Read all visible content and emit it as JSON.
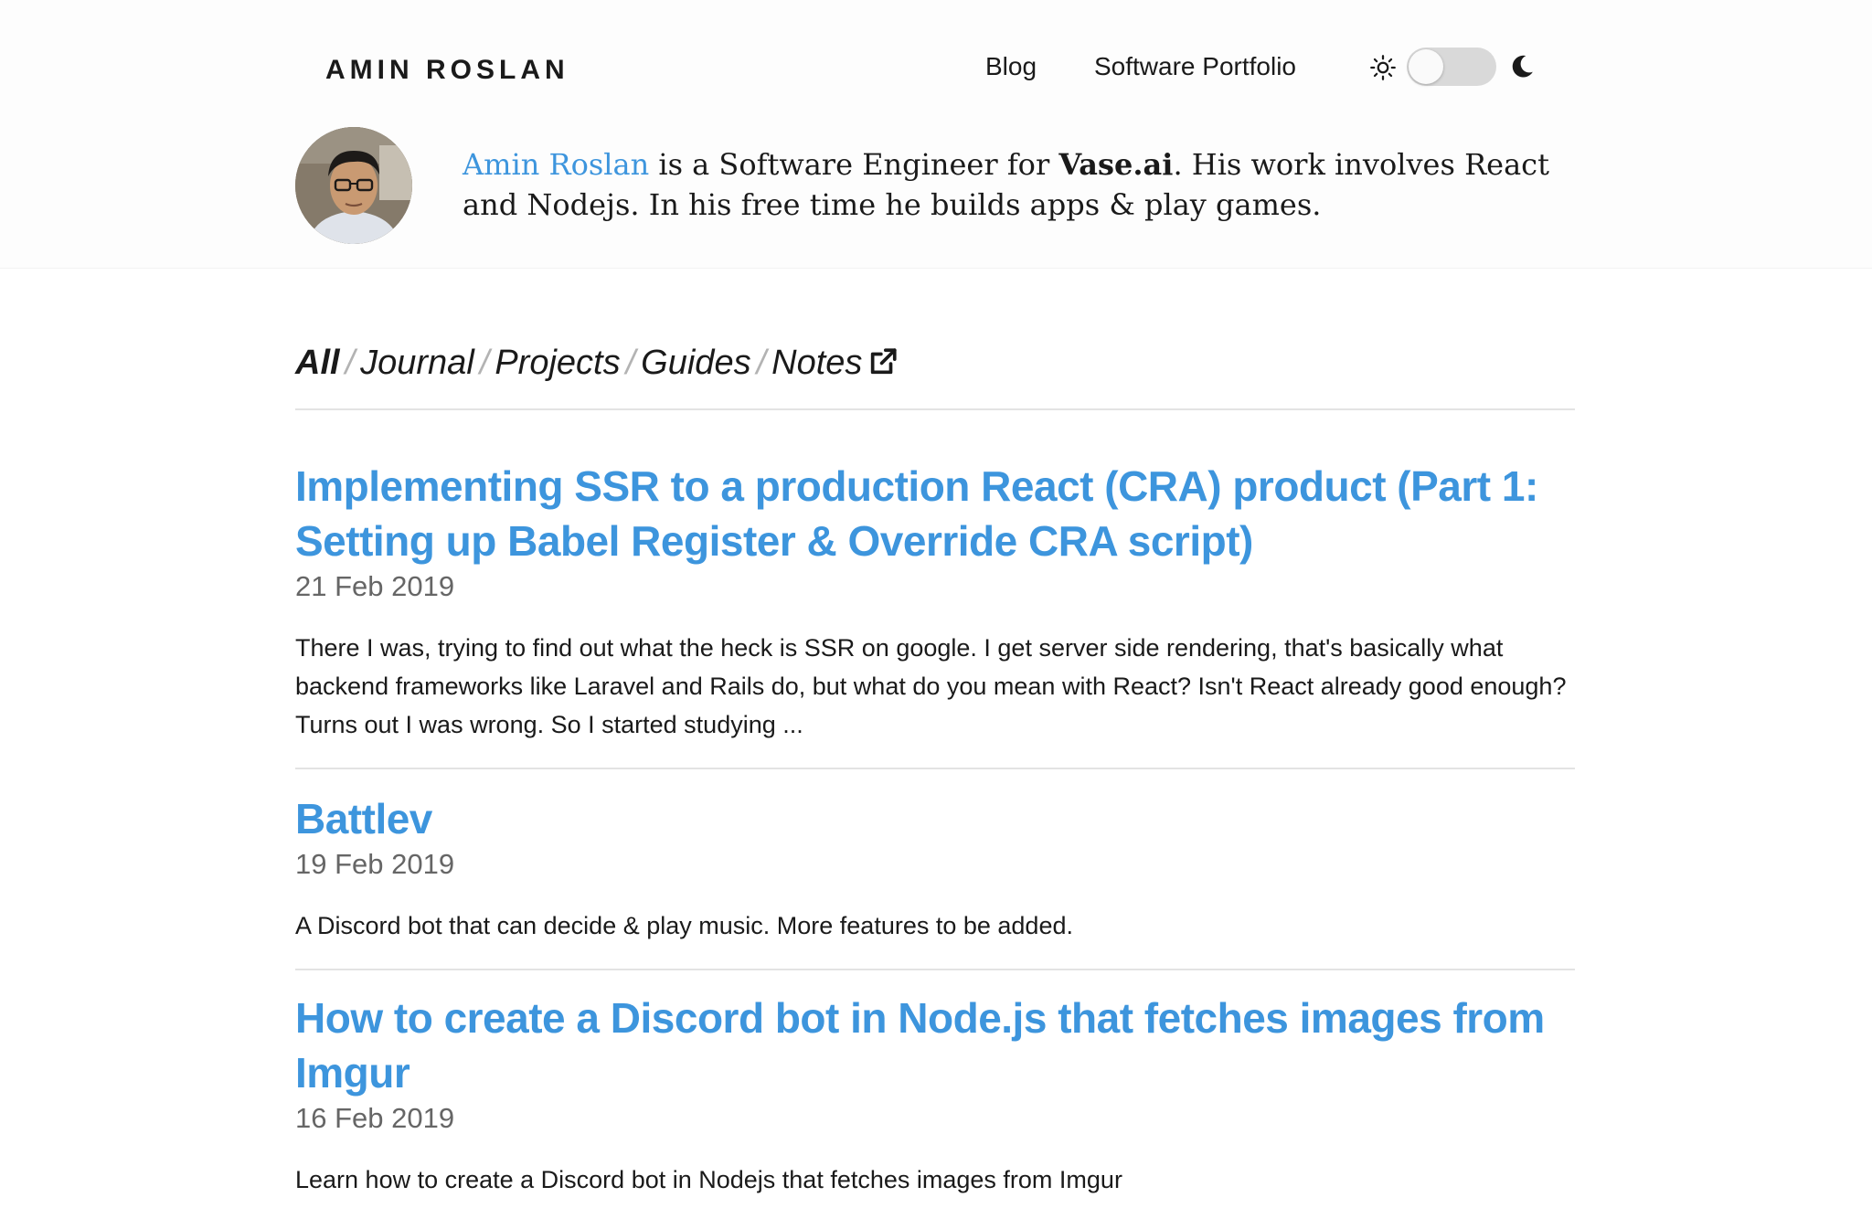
{
  "header": {
    "brand": "AMIN ROSLAN",
    "nav": {
      "blog": "Blog",
      "portfolio": "Software Portfolio"
    },
    "bio": {
      "name": "Amin Roslan",
      "text1": " is a Software Engineer for ",
      "company": "Vase.ai",
      "text2": ". His work involves React and Nodejs. In his free time he builds apps & play games."
    }
  },
  "theme_toggle": {
    "checked": false,
    "light_icon": "sun-icon",
    "dark_icon": "moon-icon"
  },
  "filters": [
    {
      "label": "All",
      "active": true
    },
    {
      "label": "Journal",
      "active": false
    },
    {
      "label": "Projects",
      "active": false
    },
    {
      "label": "Guides",
      "active": false
    },
    {
      "label": "Notes",
      "active": false,
      "external": true
    }
  ],
  "posts": [
    {
      "title": "Implementing SSR to a production React (CRA) product (Part 1: Setting up Babel Register & Override CRA script)",
      "date": "21 Feb 2019",
      "excerpt": "There I was, trying to find out what the heck is SSR on google. I get server side rendering, that's basically what backend frameworks like Laravel and Rails do, but what do you mean with React? Isn't React already good enough? Turns out I was wrong. So I started studying ..."
    },
    {
      "title": "Battlev",
      "date": "19 Feb 2019",
      "excerpt": "A Discord bot that can decide & play music. More features to be added."
    },
    {
      "title": "How to create a Discord bot in Node.js that fetches images from Imgur",
      "date": "16 Feb 2019",
      "excerpt": "Learn how to create a Discord bot in Nodejs that fetches images from Imgur"
    }
  ],
  "colors": {
    "accent": "#3d95dd",
    "text": "#1a1a1a",
    "muted": "#666666",
    "separator": "#b3b3b3",
    "rule": "#e3e3e3"
  }
}
